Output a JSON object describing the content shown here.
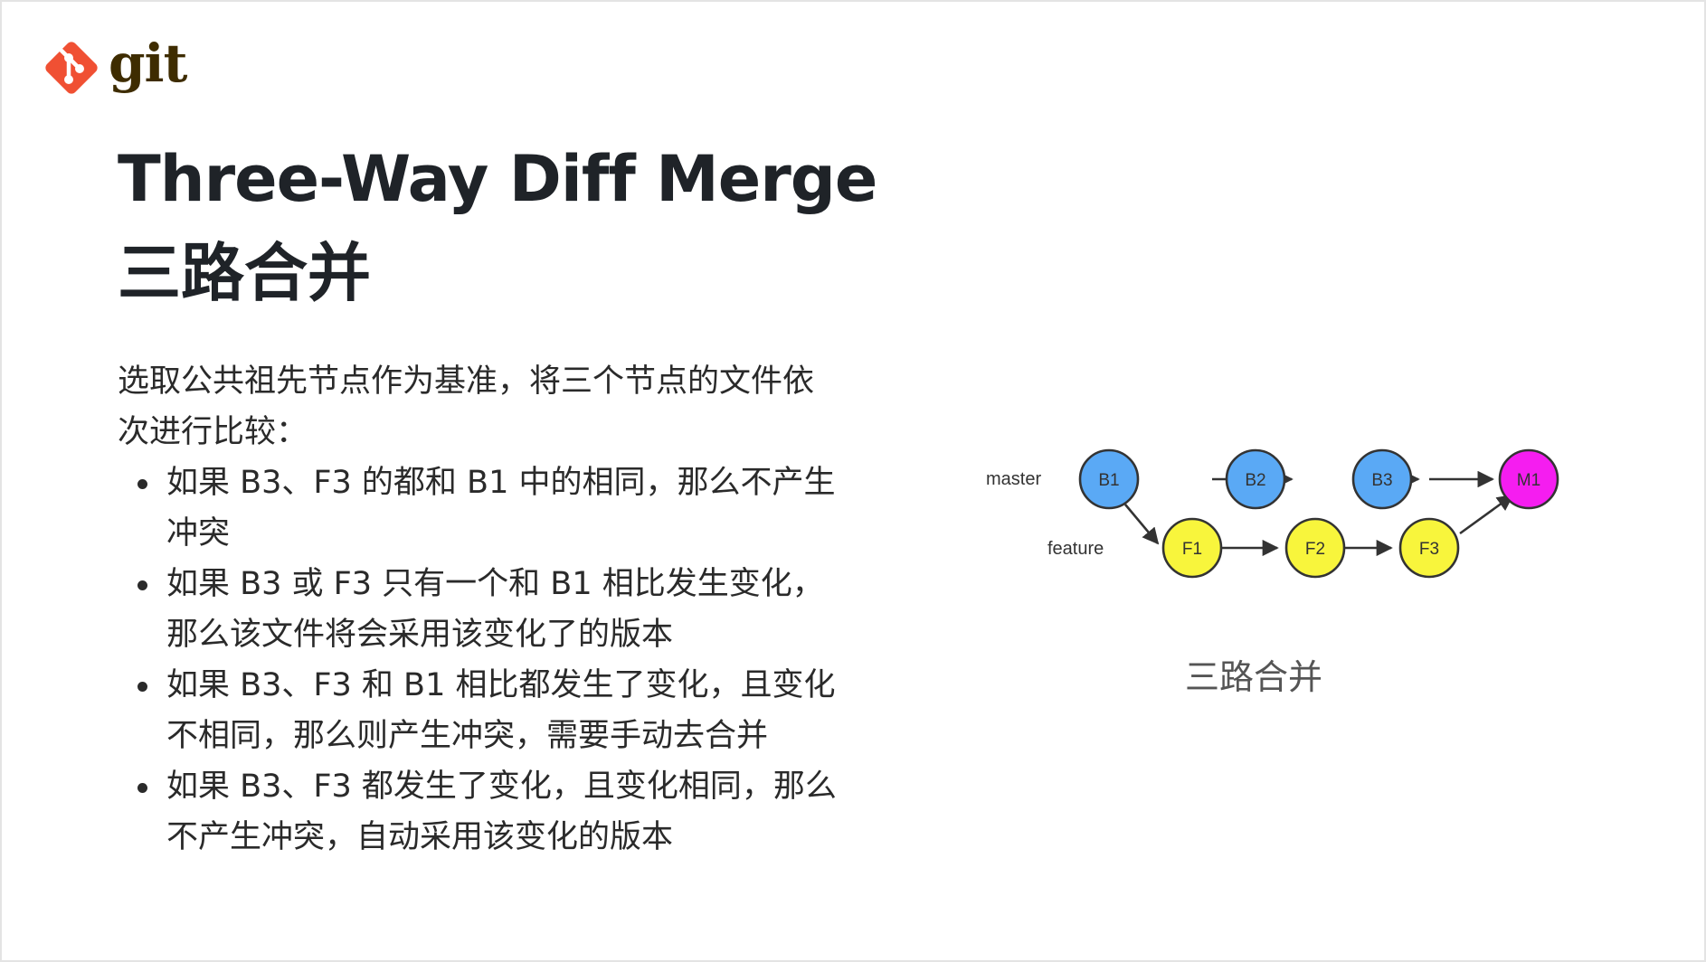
{
  "logo": {
    "text": "git",
    "color": "#f05033"
  },
  "title": {
    "english": "Three-Way Diff Merge",
    "chinese": "三路合并"
  },
  "intro": "选取公共祖先节点作为基准，将三个节点的文件依次进行比较：",
  "bullets": [
    "如果 B3、F3 的都和 B1 中的相同，那么不产生冲突",
    "如果 B3 或 F3 只有一个和 B1 相比发生变化，那么该文件将会采用该变化了的版本",
    "如果 B3、F3 和 B1 相比都发生了变化，且变化不相同，那么则产生冲突，需要手动去合并",
    "如果 B3、F3 都发生了变化，且变化相同，那么不产生冲突，自动采用该变化的版本"
  ],
  "diagram": {
    "branch_labels": {
      "master": "master",
      "feature": "feature"
    },
    "nodes": {
      "B1": {
        "label": "B1",
        "color": "#5aa9f5"
      },
      "B2": {
        "label": "B2",
        "color": "#5aa9f5"
      },
      "B3": {
        "label": "B3",
        "color": "#5aa9f5"
      },
      "M1": {
        "label": "M1",
        "color": "#f51df0"
      },
      "F1": {
        "label": "F1",
        "color": "#f8f53c"
      },
      "F2": {
        "label": "F2",
        "color": "#f8f53c"
      },
      "F3": {
        "label": "F3",
        "color": "#f8f53c"
      }
    },
    "caption": "三路合并"
  }
}
